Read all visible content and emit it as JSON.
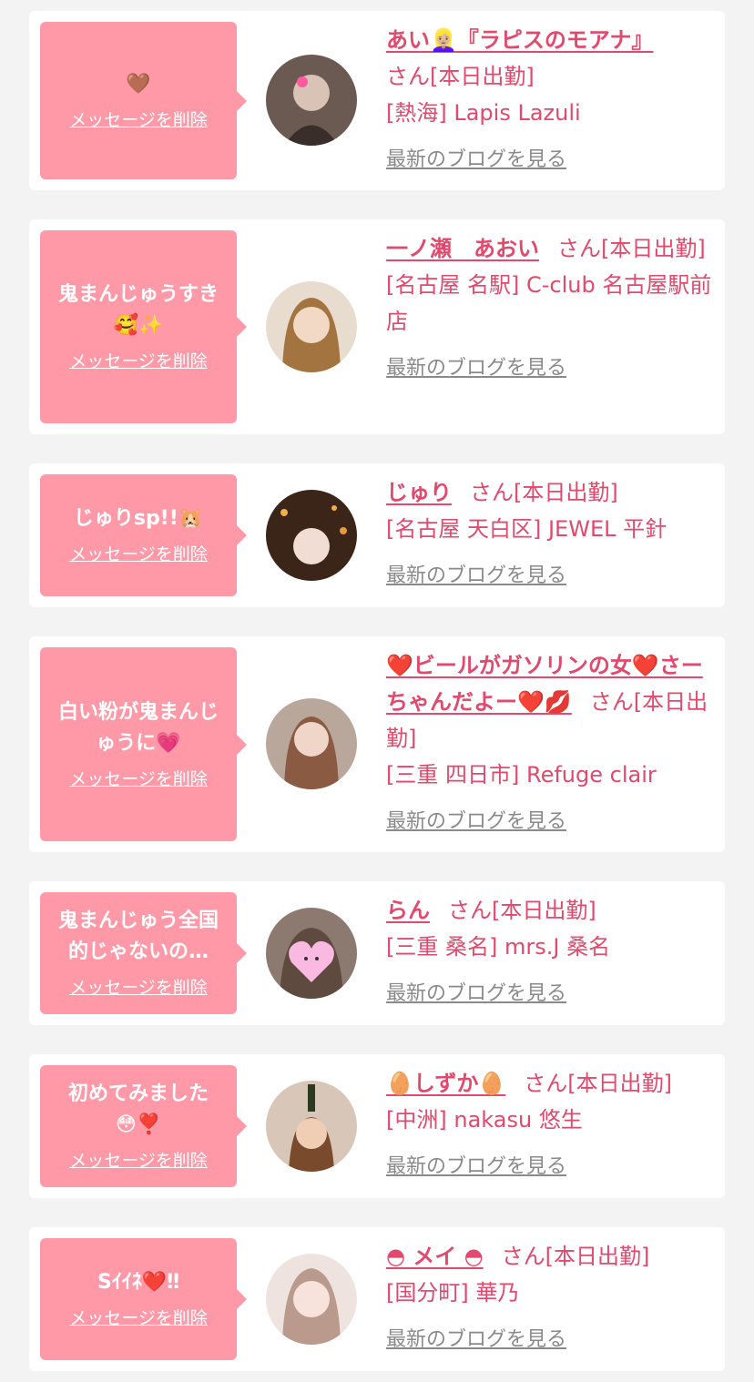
{
  "delete_label": "メッセージを削除",
  "blog_label": "最新のブログを見る",
  "san_status": "さん[本日出勤]",
  "colors": {
    "bubble": "#ff99a8",
    "accent": "#e2496d",
    "muted": "#8a8a8a",
    "background": "#f3f3f3"
  },
  "items": [
    {
      "message": "🤎",
      "name": "あい👱🏼‍♀️『ラピスのモアナ』",
      "shop": "[熱海] Lapis Lazuli",
      "avatar_icon": "avatar-photo"
    },
    {
      "message": "鬼まんじゅうすき🥰✨",
      "name": "一ノ瀬　あおい",
      "shop": "[名古屋 名駅] C-club 名古屋駅前店",
      "avatar_icon": "avatar-photo"
    },
    {
      "message": "じゅりsp!!🐹",
      "name": "じゅり",
      "shop": "[名古屋 天白区] JEWEL 平針",
      "avatar_icon": "avatar-photo"
    },
    {
      "message": "白い粉が鬼まんじゅうに💗",
      "name": "❤️ビールがガソリンの女❤️さーちゃんだよー❤️💋",
      "shop": "[三重 四日市] Refuge clair",
      "avatar_icon": "avatar-photo"
    },
    {
      "message": "鬼まんじゅう全国的じゃないの…",
      "name": "らん",
      "shop": "[三重 桑名] mrs.J 桑名",
      "avatar_icon": "avatar-photo"
    },
    {
      "message": "初めてみました😳❣️",
      "name": "🥚しずか🥚",
      "shop": "[中洲] nakasu 悠生",
      "avatar_icon": "avatar-photo"
    },
    {
      "message": "Sｲｲﾈ❤️‼",
      "name": "◓ メイ ◓",
      "shop": "[国分町] 華乃",
      "avatar_icon": "avatar-photo"
    }
  ]
}
